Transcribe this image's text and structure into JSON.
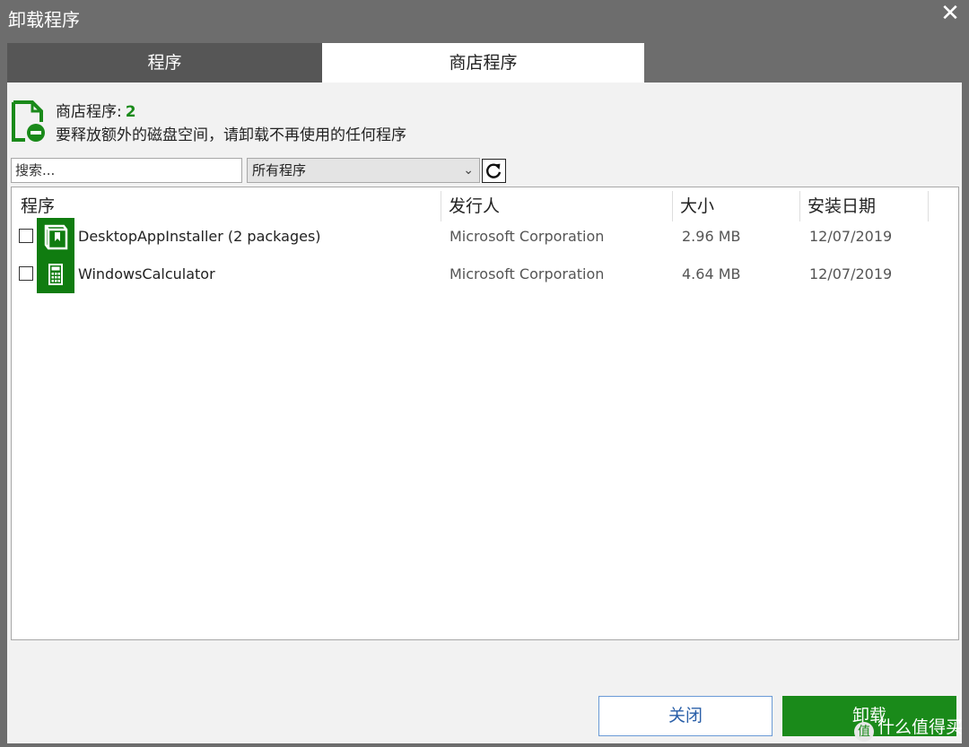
{
  "window": {
    "title": "卸载程序",
    "close_glyph": "✕"
  },
  "tabs": [
    {
      "label": "程序",
      "active": false
    },
    {
      "label": "商店程序",
      "active": true
    }
  ],
  "header": {
    "title": "商店程序:",
    "count": "2",
    "subtitle": "要释放额外的磁盘空间，请卸载不再使用的任何程序",
    "icon": "document-remove-icon"
  },
  "toolbar": {
    "search_placeholder": "搜索...",
    "filter_selected": "所有程序",
    "refresh_icon": "refresh-icon"
  },
  "table": {
    "columns": [
      "程序",
      "发行人",
      "大小",
      "安装日期"
    ],
    "rows": [
      {
        "name": "DesktopAppInstaller (2 packages)",
        "publisher": "Microsoft Corporation",
        "size": "2.96 MB",
        "date": "12/07/2019",
        "icon": "package-icon",
        "checked": false
      },
      {
        "name": "WindowsCalculator",
        "publisher": "Microsoft Corporation",
        "size": "4.64 MB",
        "date": "12/07/2019",
        "icon": "calculator-icon",
        "checked": false
      }
    ]
  },
  "buttons": {
    "close": "关闭",
    "uninstall": "卸载"
  },
  "watermark": {
    "text": "什么值得买",
    "logo": "值"
  },
  "colors": {
    "accent_green": "#1a8a1a",
    "titlebar_gray": "#6d6d6d",
    "button_blue_text": "#2a5fa8"
  }
}
